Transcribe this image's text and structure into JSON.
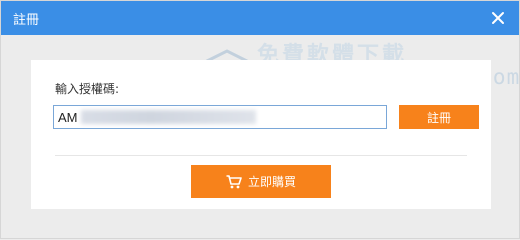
{
  "window": {
    "title": "註冊"
  },
  "watermark": {
    "chinese": "免費軟體下載",
    "url": "http://moonpoet.com"
  },
  "form": {
    "label": "輸入授權碼:",
    "code_value": "AM",
    "register_label": "註冊",
    "buy_label": "立即購買"
  },
  "icons": {
    "close": "close-icon",
    "cart": "shopping-cart-icon"
  },
  "colors": {
    "titlebar": "#3a8ee6",
    "accent": "#f7821b",
    "input_border": "#7aa7d8",
    "window_bg": "#ececec"
  }
}
